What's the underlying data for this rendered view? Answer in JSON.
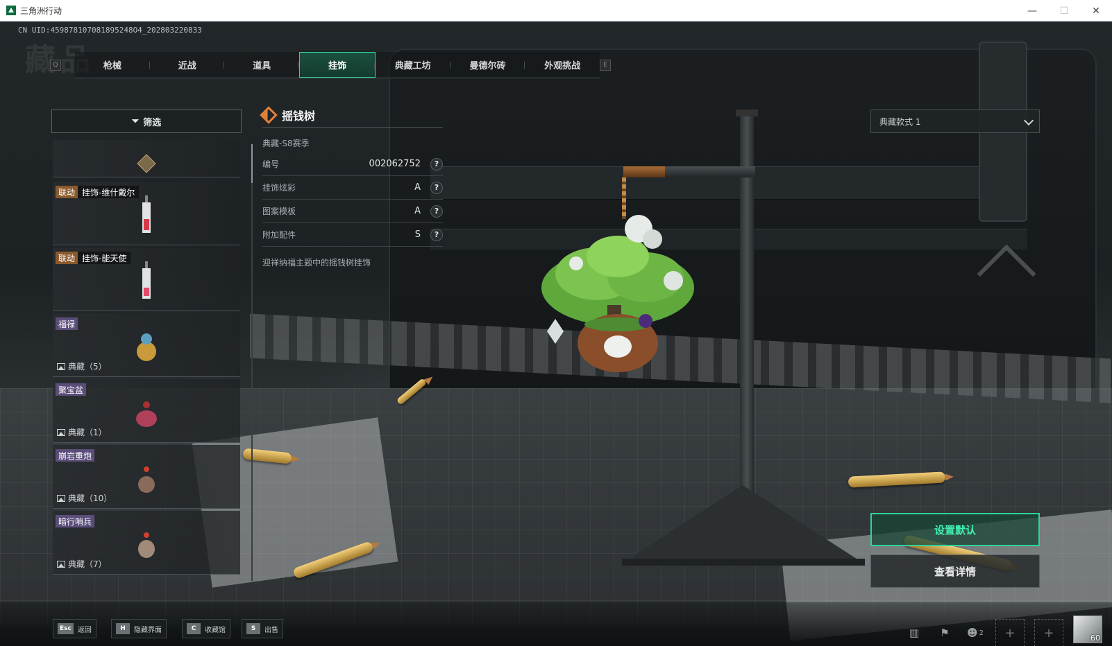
{
  "window": {
    "title": "三角洲行动",
    "minimize": "—",
    "maximize": "☐",
    "close": "✕"
  },
  "header": {
    "uid": "CN UID:459878107081895248O4_202803220833",
    "watermark": "藏品"
  },
  "tabs": {
    "prev_key": "Q",
    "next_key": "E",
    "items": [
      {
        "label": "枪械"
      },
      {
        "label": "近战"
      },
      {
        "label": "道具"
      },
      {
        "label": "挂饰",
        "active": true
      },
      {
        "label": "典藏工坊"
      },
      {
        "label": "曼德尔砖"
      },
      {
        "label": "外观挑战"
      }
    ]
  },
  "filter": {
    "label": "筛选",
    "icon": "filter-icon"
  },
  "list": {
    "items": [
      {
        "tag": "",
        "name": "",
        "count": ""
      },
      {
        "tag": "联动",
        "name": "挂饰-维什戴尔",
        "count": ""
      },
      {
        "tag": "联动",
        "name": "挂饰-能天使",
        "count": ""
      },
      {
        "tag": "福禄",
        "name": "",
        "count": "典藏（5）"
      },
      {
        "tag": "聚宝盆",
        "name": "",
        "count": "典藏（1）"
      },
      {
        "tag": "崩岩重炮",
        "name": "",
        "count": "典藏（10）"
      },
      {
        "tag": "暗行哨兵",
        "name": "",
        "count": "典藏（7）"
      }
    ]
  },
  "detail": {
    "name": "摇钱树",
    "season": "典藏-S8赛季",
    "props": [
      {
        "label": "编号",
        "value": "002062752"
      },
      {
        "label": "挂饰炫彩",
        "value": "A"
      },
      {
        "label": "图案模板",
        "value": "A"
      },
      {
        "label": "附加配件",
        "value": "S"
      }
    ],
    "help": "?",
    "description": "迎祥纳福主题中的摇钱树挂饰"
  },
  "style_select": {
    "value": "典藏款式 1"
  },
  "actions": {
    "set_default": "设置默认",
    "view_details": "查看详情"
  },
  "bottom": {
    "hints": [
      {
        "key": "Esc",
        "label": "返回"
      },
      {
        "key": "H",
        "label": "隐藏界面"
      },
      {
        "key": "C",
        "label": "收藏馆"
      },
      {
        "key": "S",
        "label": "出售"
      }
    ],
    "party_count": "2",
    "level": "60"
  },
  "colors": {
    "accent": "#2fd59b",
    "collab_tag": "#8a5a2e",
    "rare_tag": "#5b4d7a",
    "diamond": "#e2833a"
  }
}
